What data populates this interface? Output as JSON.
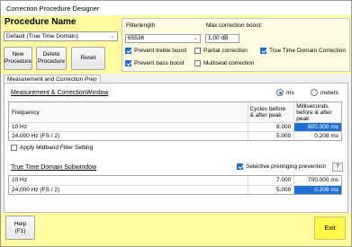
{
  "window": {
    "title": "Correction Procedure Designer"
  },
  "procedure": {
    "heading": "Procedure Name",
    "selected": "Default (True Time Domain)",
    "new_label": "New\nProcedure",
    "delete_label": "Delete\nProcedure",
    "reset_label": "Reset"
  },
  "options": {
    "filterlength_label": "Filterlength",
    "filterlength_value": "65536",
    "max_boost_label": "Max correction boost:",
    "max_boost_value": "1.00 dB",
    "prevent_treble_label": "Prevent treble boost",
    "prevent_treble_checked": true,
    "prevent_bass_label": "Prevent bass boost",
    "prevent_bass_checked": true,
    "partial_label": "Partial correction",
    "partial_checked": false,
    "multiseat_label": "Multiseat correction",
    "multiseat_checked": false,
    "ttd_label": "True Time Domain Correction",
    "ttd_checked": true
  },
  "tabs": [
    {
      "label": "Measurement and Correction Prep",
      "active": true
    }
  ],
  "measurement": {
    "title": "Measurement & CorrectionWindow",
    "unit_ms_label": "ms",
    "unit_meters_label": "meters",
    "selected_unit": "ms",
    "columns": [
      "Frequency",
      "Cycles before\n& after peak",
      "Milliseconds\nbefore & after\npeak"
    ],
    "rows": [
      {
        "freq": "10 Hz",
        "cycles": "8.000",
        "ms": "800.000 ms",
        "selected": true
      },
      {
        "freq": "24,000 Hz (FS / 2)",
        "cycles": "5.000",
        "ms": "0.208 ms",
        "selected": false
      }
    ],
    "midband_label": "Apply Midband Filter Setting",
    "midband_checked": false
  },
  "subwindow": {
    "title": "True Time Domain Subwindow",
    "preringing_label": "Selective preringing prevention",
    "preringing_checked": true,
    "help_q": "?",
    "rows": [
      {
        "freq": "10 Hz",
        "cycles": "7.000",
        "ms": "700.000 ms",
        "selected": false
      },
      {
        "freq": "24,000 Hz (FS / 2)",
        "cycles": "5.000",
        "ms": "0.208 ms",
        "selected": true
      }
    ]
  },
  "footer": {
    "help_label": "Help\n(F1)",
    "exit_label": "Exit"
  },
  "colors": {
    "panel": "#fffca0",
    "accent": "#1e6fd0",
    "exit": "#fff94a"
  }
}
